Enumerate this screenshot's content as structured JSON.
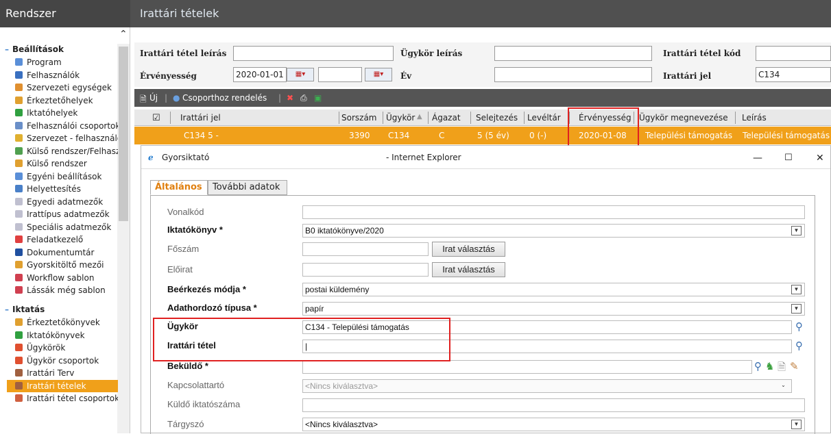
{
  "header": {
    "system_label": "Rendszer",
    "page_title": "Irattári tételek"
  },
  "sidebar": {
    "sections": [
      {
        "title": "Beállítások",
        "items": [
          "Program",
          "Felhasználók",
          "Szervezeti egységek",
          "Érkeztetőhelyek",
          "Iktatóhelyek",
          "Felhasználói csoportok",
          "Szervezet - felhasználó",
          "Külső rendszer/Felhasz",
          "Külső rendszer",
          "Egyéni beállítások",
          "Helyettesítés",
          "Egyedi adatmezők",
          "Irattípus adatmezők",
          "Speciális adatmezők",
          "Feladatkezelő",
          "Dokumentumtár",
          "Gyorskitöltő mezői",
          "Workflow sablon",
          "Lássák még sablon"
        ]
      },
      {
        "title": "Iktatás",
        "items": [
          "Érkeztetőkönyvek",
          "Iktatókönyvek",
          "Ügykörök",
          "Ügykör csoportok",
          "Irattári Terv",
          "Irattári tételek",
          "Irattári tétel csoportok"
        ]
      }
    ],
    "selected": "Irattári tételek"
  },
  "filter": {
    "tetel_leiras_label": "Irattári tétel leírás",
    "tetel_leiras_value": "",
    "ugykor_leiras_label": "Ügykör leírás",
    "ugykor_leiras_value": "",
    "tetel_kod_label": "Irattári tétel kód",
    "tetel_kod_value": "",
    "ervenyesseg_label": "Érvényesség",
    "ervenyesseg_from": "2020-01-01",
    "ervenyesseg_to": "",
    "ev_label": "Év",
    "ev_value": "",
    "irattari_jel_label": "Irattári jel",
    "irattari_jel_value": "C134"
  },
  "toolbar": {
    "new_label": "Új",
    "group_label": "Csoporthoz rendelés"
  },
  "grid": {
    "columns": [
      "Irattári jel",
      "Sorszám",
      "Ügykör",
      "Ágazat",
      "Selejtezés",
      "Levéltár",
      "Érvényesség",
      "Ügykör megnevezése",
      "Leírás"
    ],
    "rows": [
      [
        "C134 5 -",
        "3390",
        "C134",
        "C",
        "5 (5 év)",
        "0 (-)",
        "2020-01-08",
        "Települési támogatás",
        "Települési támogatás"
      ]
    ]
  },
  "popup": {
    "title_left": "Gyorsiktató",
    "title_mid": "- Internet Explorer",
    "tabs": [
      "Általános",
      "További adatok"
    ],
    "fields": {
      "vonalkod_label": "Vonalkód",
      "vonalkod_value": "",
      "iktatokonyv_label": "Iktatókönyv *",
      "iktatokonyv_value": "B0 iktatókönyve/2020",
      "foszam_label": "Főszám",
      "foszam_value": "",
      "eloirat_label": "Előirat",
      "eloirat_value": "",
      "irat_valasztas": "Irat választás",
      "beerkezes_label": "Beérkezés módja *",
      "beerkezes_value": "postai küldemény",
      "adathordozo_label": "Adathordozó típusa *",
      "adathordozo_value": "papír",
      "ugykor_label": "Ügykör",
      "ugykor_value": "C134 - Települési támogatás",
      "irattari_tetel_label": "Irattári tétel",
      "irattari_tetel_value": "|",
      "bekuldo_label": "Beküldő *",
      "bekuldo_value": "",
      "kapcsolattarto_label": "Kapcsolattartó",
      "kapcsolattarto_value": "<Nincs kiválasztva>",
      "kuldo_iktatoszama_label": "Küldő iktatószáma",
      "kuldo_iktatoszama_value": "",
      "targyszo_label": "Tárgyszó",
      "targyszo_value": "<Nincs kiválasztva>"
    }
  },
  "colors": {
    "accent": "#f0a01a",
    "header_bg": "#505050",
    "highlight": "#e02020"
  }
}
